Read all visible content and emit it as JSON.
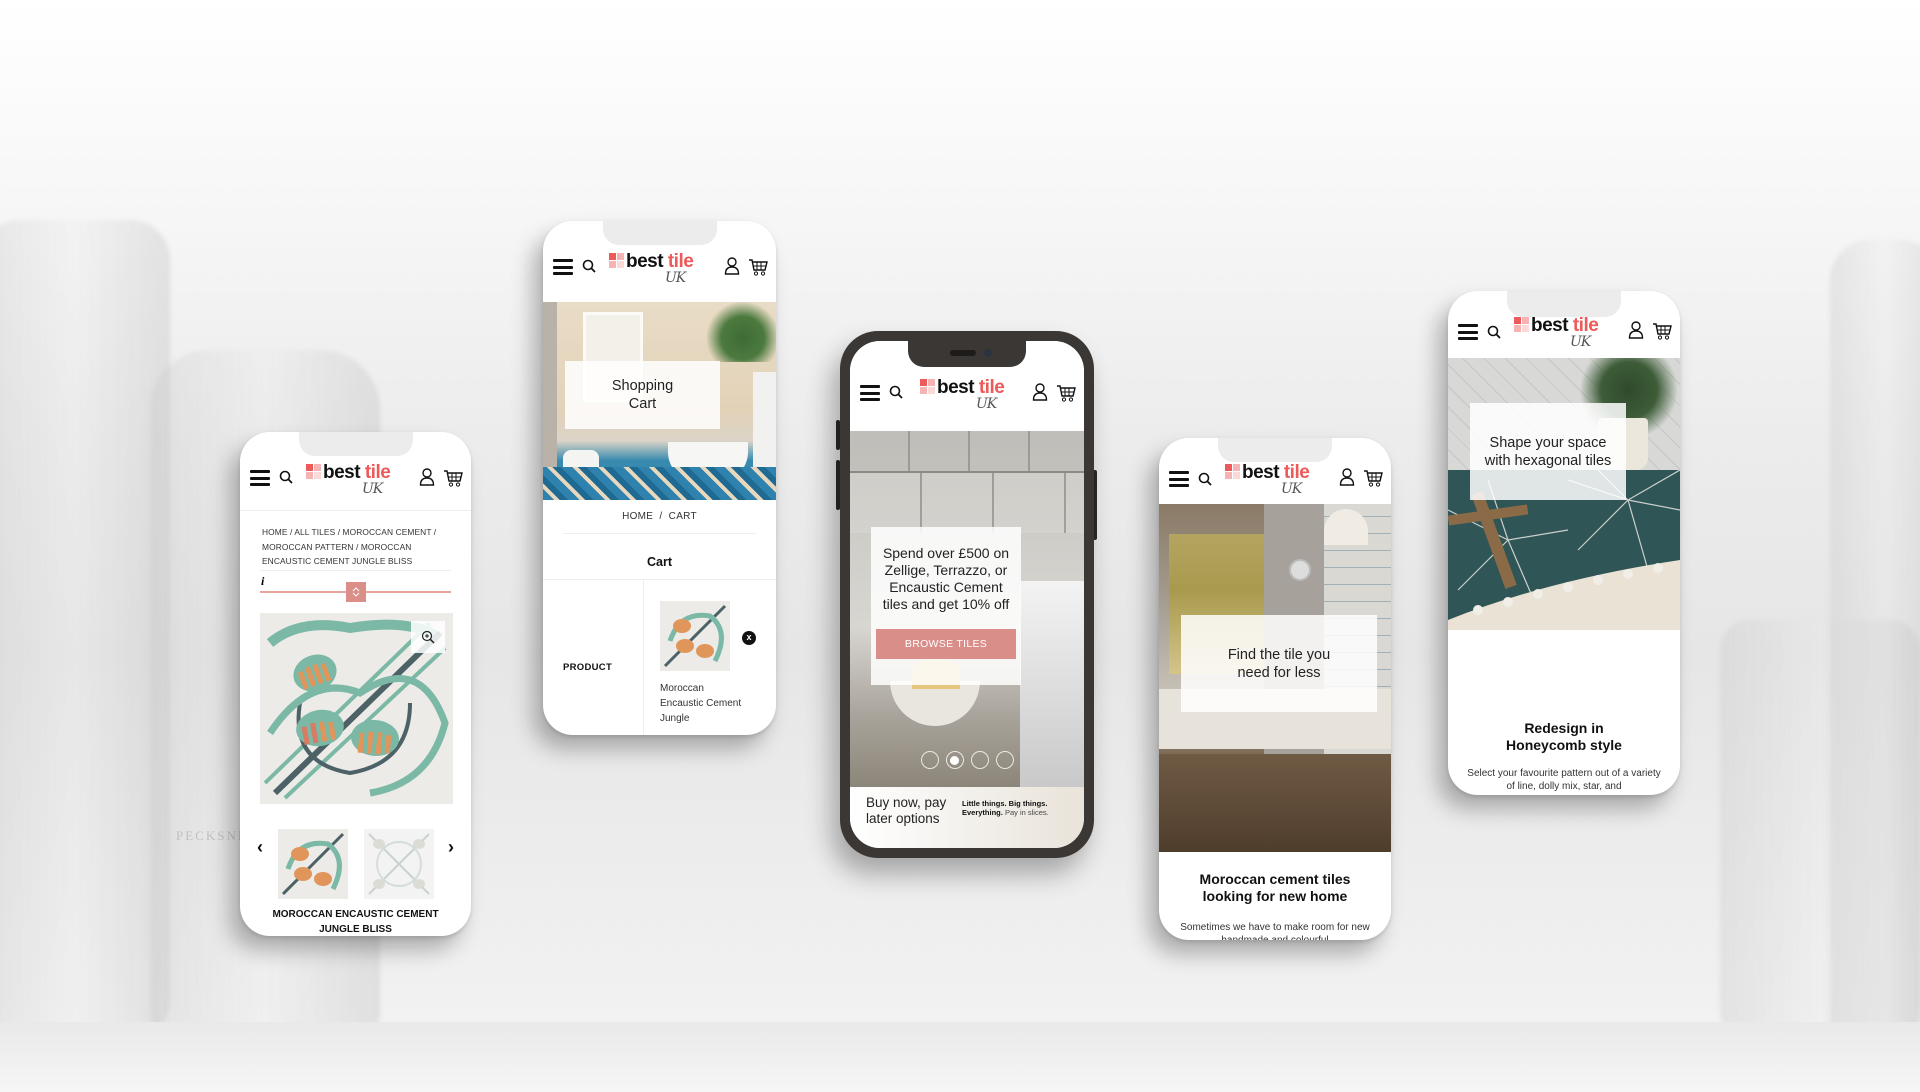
{
  "brand": {
    "logo_word_1": "best",
    "logo_word_2": "tile",
    "logo_sub": "UK",
    "accent_color": "#ee5a5a",
    "button_color": "#d98e8a"
  },
  "header_icons": [
    "menu-icon",
    "search-icon",
    "user-icon",
    "cart-icon"
  ],
  "phones": {
    "product": {
      "breadcrumb": "HOME / ALL TILES / MOROCCAN CEMENT / MOROCCAN PATTERN / MOROCCAN ENCAUSTIC CEMENT JUNGLE BLISS",
      "info_label": "i",
      "zoom_icon": "zoom-in-icon",
      "prev_label": "‹",
      "next_label": "›",
      "product_title": "MOROCCAN ENCAUSTIC CEMENT JUNGLE BLISS"
    },
    "cart": {
      "hero_title": "Shopping Cart",
      "breadcrumb": "HOME  /  CART",
      "section_title": "Cart",
      "column_label": "PRODUCT",
      "item_name": "Moroccan Encaustic Cement Jungle",
      "remove_label": "x"
    },
    "home": {
      "promo_text": "Spend over £500 on Zellige, Terrazzo, or Encaustic Cement tiles and get 10% off",
      "cta_label": "BROWSE TILES",
      "carousel_count": 4,
      "carousel_active": 2,
      "pay_later_title": "Buy now, pay later options",
      "ad_line_1": "Little things. Big things.",
      "ad_line_2_bold": "Everything.",
      "ad_line_2_rest": "Pay in slices."
    },
    "clearance": {
      "hero_text": "Find the tile you need for less",
      "title": "Moroccan cement tiles looking for new home",
      "body": "Sometimes we have to make room for new handmade and colourful"
    },
    "hexagon": {
      "hero_text": "Shape your space with hexagonal tiles",
      "title": "Redesign in Honeycomb style",
      "body": "Select your favourite pattern out of a variety of line, dolly mix, star, and"
    }
  }
}
